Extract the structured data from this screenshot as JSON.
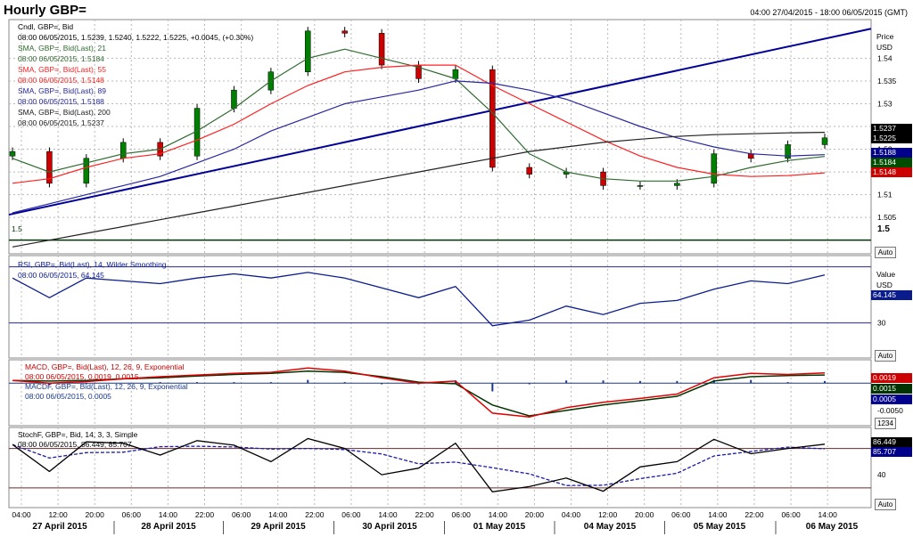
{
  "header": {
    "title": "Hourly GBP=",
    "range": "04:00 27/04/2015 - 18:00 06/05/2015 (GMT)"
  },
  "colors": {
    "candle_up": "#008000",
    "candle_down": "#cc0000",
    "sma21": "#2f6b2f",
    "sma55": "#ff2020",
    "sma89": "#2828a0",
    "sma200": "#202020",
    "trend": "#000099",
    "rsi": "#0a1c8c",
    "macd": "#e00000",
    "macd_signal": "#003300",
    "stoch_k": "#000000",
    "stoch_d": "#1a1aaa",
    "tag_price": "#000000",
    "tag_sma89": "#00008b",
    "tag_sma21": "#004d00",
    "tag_sma55": "#cc0000"
  },
  "price_panel": {
    "legend": [
      "Cndl, GBP=, Bid",
      "08:00 06/05/2015, 1.5239, 1.5240, 1.5222, 1.5225, +0.0045, (+0.30%)",
      "SMA, GBP=, Bid(Last), 21",
      "08:00 06/05/2015, 1.5184",
      "SMA, GBP=, Bid(Last), 55",
      "08:00 06/05/2015, 1.5148",
      "SMA, GBP=, Bid(Last), 89",
      "08:00 06/05/2015, 1.5188",
      "SMA, GBP=, Bid(Last), 200",
      "08:00 06/05/2015, 1.5237"
    ],
    "axis_title": [
      "Price",
      "USD"
    ],
    "ticks": [
      "1.54",
      "1.535",
      "1.53",
      "1.525",
      "1.52",
      "1.515",
      "1.51",
      "1.505",
      "1.5"
    ],
    "tags": [
      "1.5237",
      "1.5225",
      "1.5188",
      "1.5184",
      "1.5148"
    ],
    "level_label": "1.5",
    "auto": "Auto"
  },
  "rsi_panel": {
    "legend": [
      "RSI, GBP=, Bid(Last), 14, Wilder Smoothing",
      "08:00 06/05/2015, 64.145"
    ],
    "axis_title": [
      "Value",
      "USD"
    ],
    "ticks": [
      "30"
    ],
    "tag": "64.145",
    "auto": "Auto"
  },
  "macd_panel": {
    "legend": [
      "MACD, GBP=, Bid(Last), 12, 26, 9, Exponential",
      "08:00 06/05/2015, 0.0019, 0.0015",
      "MACDF, GBP=, Bid(Last), 12, 26, 9, Exponential",
      "08:00 06/05/2015, 0.0005"
    ],
    "ticks": [
      "-0.0050"
    ],
    "tags": [
      "0.0019",
      "0.0015",
      "0.0005"
    ],
    "auto": "1234"
  },
  "stoch_panel": {
    "legend": [
      "StochF, GBP=, Bid, 14, 3, 3, Simple",
      "08:00 06/05/2015, 86.449, 85.707"
    ],
    "ticks": [
      "40"
    ],
    "tags": [
      "86.449",
      "85.707"
    ],
    "auto": "Auto"
  },
  "x_axis": {
    "times": [
      "04:00",
      "12:00",
      "20:00",
      "06:00",
      "14:00",
      "22:00",
      "06:00",
      "14:00",
      "22:00",
      "06:00",
      "14:00",
      "22:00",
      "06:00",
      "14:00",
      "20:00",
      "04:00",
      "12:00",
      "20:00",
      "06:00",
      "14:00",
      "22:00",
      "06:00",
      "14:00"
    ],
    "dates": [
      "27 April 2015",
      "28 April 2015",
      "29 April 2015",
      "30 April 2015",
      "01 May 2015",
      "04 May 2015",
      "05 May 2015",
      "06 May 2015"
    ]
  },
  "chart_data": {
    "type": "line",
    "title": "Hourly GBP=",
    "ylabel": "Price USD",
    "ylim": [
      1.497,
      1.5485
    ],
    "x": [
      "27/04 04:00",
      "27/04 12:00",
      "27/04 20:00",
      "28/04 06:00",
      "28/04 14:00",
      "28/04 22:00",
      "29/04 06:00",
      "29/04 14:00",
      "29/04 22:00",
      "30/04 06:00",
      "30/04 14:00",
      "30/04 22:00",
      "01/05 06:00",
      "01/05 14:00",
      "01/05 20:00",
      "04/05 04:00",
      "04/05 12:00",
      "04/05 20:00",
      "05/05 06:00",
      "05/05 14:00",
      "05/05 22:00",
      "06/05 06:00",
      "06/05 08:00"
    ],
    "series": [
      {
        "name": "Cndl, GBP=, Bid",
        "values": [
          1.5195,
          1.5125,
          1.518,
          1.5215,
          1.5185,
          1.529,
          1.533,
          1.537,
          1.546,
          1.5455,
          1.5385,
          1.5355,
          1.5375,
          1.516,
          1.5145,
          1.515,
          1.512,
          1.512,
          1.5125,
          1.519,
          1.518,
          1.521,
          1.5225
        ]
      },
      {
        "name": "SMA, GBP=, Bid(Last), 21",
        "values": [
          1.518,
          1.515,
          1.517,
          1.519,
          1.52,
          1.524,
          1.529,
          1.535,
          1.54,
          1.542,
          1.54,
          1.538,
          1.5355,
          1.528,
          1.519,
          1.515,
          1.5135,
          1.513,
          1.513,
          1.514,
          1.516,
          1.5175,
          1.5184
        ]
      },
      {
        "name": "SMA, GBP=, Bid(Last), 55",
        "values": [
          1.5125,
          1.5135,
          1.516,
          1.518,
          1.519,
          1.522,
          1.5255,
          1.53,
          1.534,
          1.537,
          1.538,
          1.5385,
          1.5385,
          1.534,
          1.53,
          1.526,
          1.522,
          1.5185,
          1.516,
          1.5145,
          1.514,
          1.5142,
          1.5148
        ]
      },
      {
        "name": "SMA, GBP=, Bid(Last), 89",
        "values": [
          1.506,
          1.508,
          1.51,
          1.512,
          1.514,
          1.517,
          1.52,
          1.524,
          1.527,
          1.53,
          1.5315,
          1.533,
          1.535,
          1.5345,
          1.533,
          1.531,
          1.528,
          1.525,
          1.5225,
          1.5205,
          1.519,
          1.5185,
          1.5188
        ]
      },
      {
        "name": "SMA, GBP=, Bid(Last), 200",
        "values": [
          1.4985,
          1.5,
          1.5015,
          1.503,
          1.5045,
          1.506,
          1.5075,
          1.509,
          1.5105,
          1.512,
          1.5135,
          1.515,
          1.5165,
          1.518,
          1.5195,
          1.5205,
          1.5215,
          1.5222,
          1.5228,
          1.5232,
          1.5234,
          1.5236,
          1.5237
        ]
      },
      {
        "name": "RSI, GBP=, Bid(Last), 14, Wilder Smoothing",
        "values": [
          62,
          48,
          62,
          60,
          58,
          62,
          65,
          62,
          66,
          62,
          55,
          48,
          56,
          28,
          32,
          42,
          36,
          44,
          46,
          54,
          60,
          58,
          64.145
        ]
      },
      {
        "name": "MACD, GBP=, Bid(Last), 12, 26, 9, Exponential",
        "values": [
          0.0005,
          0.0,
          0.0003,
          0.0008,
          0.0012,
          0.0015,
          0.0018,
          0.002,
          0.0028,
          0.0022,
          0.001,
          0.0,
          0.0004,
          -0.0055,
          -0.0062,
          -0.0045,
          -0.0035,
          -0.0028,
          -0.002,
          0.001,
          0.0018,
          0.0016,
          0.0019
        ]
      },
      {
        "name": "MACDF, GBP=, Bid(Last), 12, 26, 9, Exponential",
        "values": [
          0.0005,
          0.0004,
          0.0005,
          0.0008,
          0.001,
          0.0013,
          0.0016,
          0.0018,
          0.0022,
          0.002,
          0.0012,
          0.0002,
          -0.0001,
          -0.004,
          -0.006,
          -0.005,
          -0.004,
          -0.0032,
          -0.0024,
          0.0004,
          0.0012,
          0.0014,
          0.0015
        ]
      },
      {
        "name": "StochF, GBP=, Bid, 14, 3, 3, Simple",
        "values": [
          86,
          45,
          90,
          88,
          70,
          92,
          85,
          60,
          95,
          80,
          40,
          50,
          88,
          14,
          22,
          35,
          15,
          52,
          60,
          94,
          72,
          80,
          86.449
        ]
      }
    ]
  }
}
